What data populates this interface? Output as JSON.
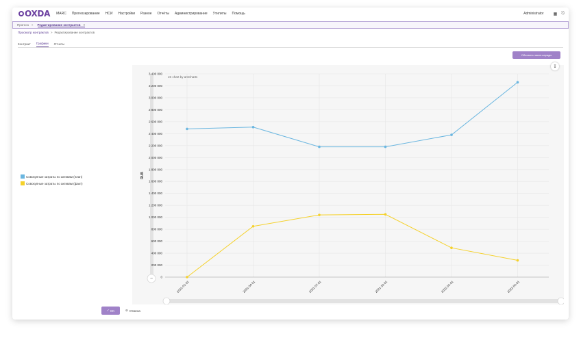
{
  "nav": {
    "logo": "OXDA",
    "menu": [
      "MARC",
      "Прогнозирование",
      "НСИ",
      "Настройки",
      "Разное",
      "Отчёты",
      "Администрирование",
      "Утилиты",
      "Помощь"
    ],
    "user": "Administrator",
    "icons": [
      "grid-icon",
      "logout-icon"
    ]
  },
  "tabs": [
    {
      "label": "Прогноз",
      "active": false
    },
    {
      "label": "Редактирование контрактов",
      "active": true
    }
  ],
  "breadcrumb": {
    "link": "Просмотр контрактов",
    "sep": ">",
    "current": "Редактирование контрактов"
  },
  "subtabs": [
    {
      "label": "Контракт",
      "active": false
    },
    {
      "label": "Графики",
      "active": true
    },
    {
      "label": "Отчеты",
      "active": false
    }
  ],
  "refresh_label": "Обновить закон-карады",
  "buttons": {
    "ok": "OK",
    "cancel": "Отмена"
  },
  "colors": {
    "plan": "#6ab6e0",
    "fact": "#f5d12a",
    "accent": "#a082c8"
  },
  "chart_data": {
    "type": "line",
    "credit": "JS chart by amCharts",
    "ylabel": "RUB",
    "ylim": [
      0,
      3400000
    ],
    "yticks": [
      "0",
      "200 000",
      "400 000",
      "600 000",
      "800 000",
      "1 000 000",
      "1 200 000",
      "1 400 000",
      "1 600 000",
      "1 800 000",
      "2 000 000",
      "2 200 000",
      "2 400 000",
      "2 600 000",
      "2 800 000",
      "3 000 000",
      "3 200 000",
      "3 400 000"
    ],
    "x": [
      "2021-01-01",
      "2021-04-01",
      "2021-07-01",
      "2021-10-01",
      "2022-01-01",
      "2022-04-01"
    ],
    "series": [
      {
        "name": "Совокупные затраты по активам (план)",
        "color": "#6ab6e0",
        "values": [
          2480000,
          2510000,
          2180000,
          2180000,
          2380000,
          3260000
        ]
      },
      {
        "name": "Совокупные затраты по активам (факт)",
        "color": "#f5d12a",
        "values": [
          0,
          850000,
          1040000,
          1050000,
          490000,
          280000
        ]
      }
    ]
  }
}
